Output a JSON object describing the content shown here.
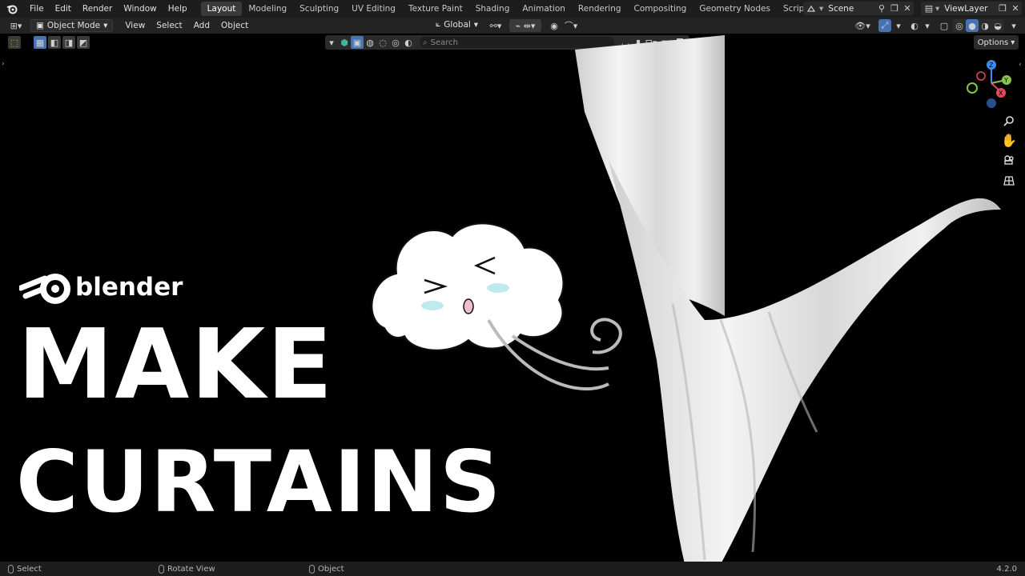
{
  "topbar": {
    "menus": [
      "File",
      "Edit",
      "Render",
      "Window",
      "Help"
    ],
    "workspaces": [
      {
        "label": "Layout",
        "active": true
      },
      {
        "label": "Modeling",
        "active": false
      },
      {
        "label": "Sculpting",
        "active": false
      },
      {
        "label": "UV Editing",
        "active": false
      },
      {
        "label": "Texture Paint",
        "active": false
      },
      {
        "label": "Shading",
        "active": false
      },
      {
        "label": "Animation",
        "active": false
      },
      {
        "label": "Rendering",
        "active": false
      },
      {
        "label": "Compositing",
        "active": false
      },
      {
        "label": "Geometry Nodes",
        "active": false
      },
      {
        "label": "Scripting",
        "active": false
      }
    ],
    "add_tab": "+",
    "scene": "Scene",
    "view_layer": "ViewLayer"
  },
  "header": {
    "mode": "Object Mode",
    "menus": [
      "View",
      "Select",
      "Add",
      "Object"
    ],
    "orientation": "Global",
    "options_label": "Options"
  },
  "outliner": {
    "search_placeholder": "Search"
  },
  "thumbnail": {
    "brand": "blender",
    "line1": "MAKE",
    "line2": "CURTAINS"
  },
  "gizmo": {
    "x": "X",
    "y": "Y",
    "z": "Z"
  },
  "statusbar": {
    "select": "Select",
    "rotate": "Rotate View",
    "object": "Object",
    "version": "4.2.0"
  },
  "colors": {
    "accent": "#4772b3",
    "gizmo_x": "#e8485a",
    "gizmo_y": "#8bc34a",
    "gizmo_z": "#3f8cf0",
    "active_tab": "#3a3a3a"
  }
}
